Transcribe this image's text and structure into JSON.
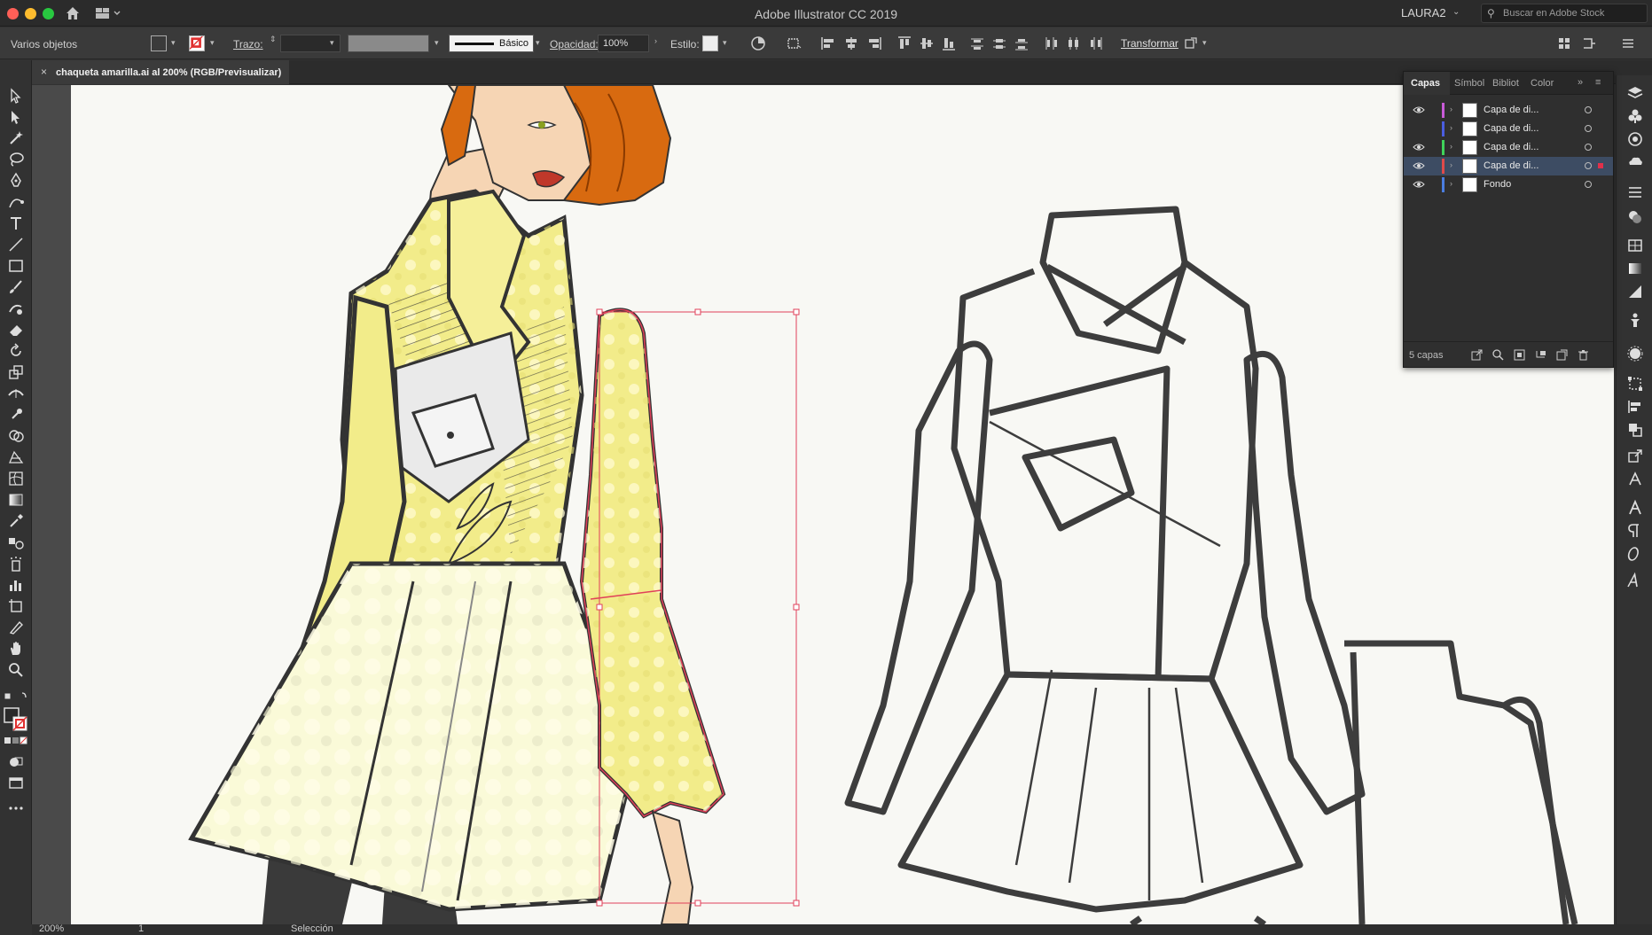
{
  "window": {
    "app_title": "Adobe Illustrator CC 2019",
    "user": "LAURA2",
    "stock_search_placeholder": "Buscar en Adobe Stock"
  },
  "control_bar": {
    "selection_label": "Varios objetos",
    "stroke_label": "Trazo:",
    "stroke_weight": "",
    "brush_profile": "Básico",
    "opacity_label": "Opacidad:",
    "opacity_value": "100%",
    "style_label": "Estilo:",
    "transform_label": "Transformar"
  },
  "document": {
    "tab_name": "chaqueta amarilla.ai al 200% (RGB/Previsualizar)"
  },
  "layers_panel": {
    "tabs": [
      "Capas",
      "Símbol",
      "Bibliot",
      "Color"
    ],
    "active_tab": "Capas",
    "layers": [
      {
        "name": "Capa de di...",
        "visible": true,
        "color": "#c85ad8",
        "selected": false
      },
      {
        "name": "Capa de di...",
        "visible": false,
        "color": "#4a5de0",
        "selected": false
      },
      {
        "name": "Capa de di...",
        "visible": true,
        "color": "#3fd35a",
        "selected": false
      },
      {
        "name": "Capa de di...",
        "visible": true,
        "color": "#e04a4a",
        "selected": true
      },
      {
        "name": "Fondo",
        "visible": true,
        "color": "#4a7de0",
        "selected": false
      }
    ],
    "layer_count": "5 capas"
  },
  "status_bar": {
    "zoom": "200%",
    "artboard_number": "1",
    "current_tool": "Selección"
  },
  "colors": {
    "jacket_yellow": "#f2ec8a",
    "selection_red": "#e0405a",
    "hair_orange": "#d86a10"
  }
}
